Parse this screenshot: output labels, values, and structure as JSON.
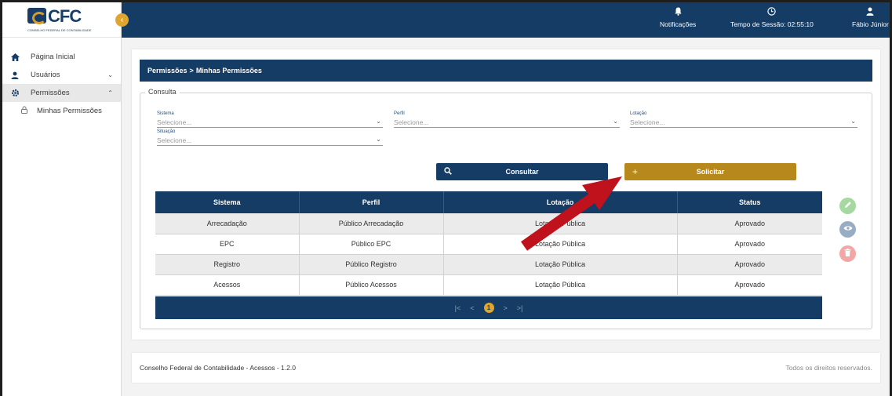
{
  "brand": {
    "logo_text": "CFC",
    "logo_subtext": "CONSELHO FEDERAL DE CONTABILIDADE"
  },
  "sidebar": {
    "toggle_icon": "chevron-left-icon",
    "items": [
      {
        "label": "Página Inicial",
        "icon": "home-icon"
      },
      {
        "label": "Usuários",
        "icon": "user-icon"
      },
      {
        "label": "Permissões",
        "icon": "gear-icon"
      }
    ],
    "sub_items": [
      {
        "label": "Minhas Permissões",
        "icon": "lock-icon"
      }
    ]
  },
  "header": {
    "notifications_label": "Notificações",
    "session_label": "Tempo de Sessão: 02:55:10",
    "user_name": "Fábio Júnior"
  },
  "breadcrumb": {
    "parent": "Permissões",
    "separator": ">",
    "current": "Minhas Permissões"
  },
  "form": {
    "legend": "Consulta",
    "fields": [
      {
        "label": "Sistema",
        "value": "Selecione..."
      },
      {
        "label": "Perfil",
        "value": "Selecione..."
      },
      {
        "label": "Lotação",
        "value": "Selecione..."
      },
      {
        "label": "Situação",
        "value": "Selecione..."
      }
    ],
    "consult_button": "Consultar",
    "request_button": "Solicitar"
  },
  "table": {
    "columns": [
      "Sistema",
      "Perfil",
      "Lotação",
      "Status"
    ],
    "rows": [
      [
        "Arrecadação",
        "Público Arrecadação",
        "Lotação Pública",
        "Aprovado"
      ],
      [
        "EPC",
        "Público EPC",
        "Lotação Pública",
        "Aprovado"
      ],
      [
        "Registro",
        "Público Registro",
        "Lotação Pública",
        "Aprovado"
      ],
      [
        "Acessos",
        "Público Acessos",
        "Lotação Pública",
        "Aprovado"
      ]
    ],
    "pagination": {
      "current_page": "1"
    }
  },
  "footer": {
    "left": "Conselho Federal de Contabilidade - Acessos - 1.2.0",
    "right": "Todos os direitos reservados."
  },
  "colors": {
    "primary": "#153c64",
    "accent": "#b7891c",
    "annotation_arrow": "#c0121c"
  }
}
